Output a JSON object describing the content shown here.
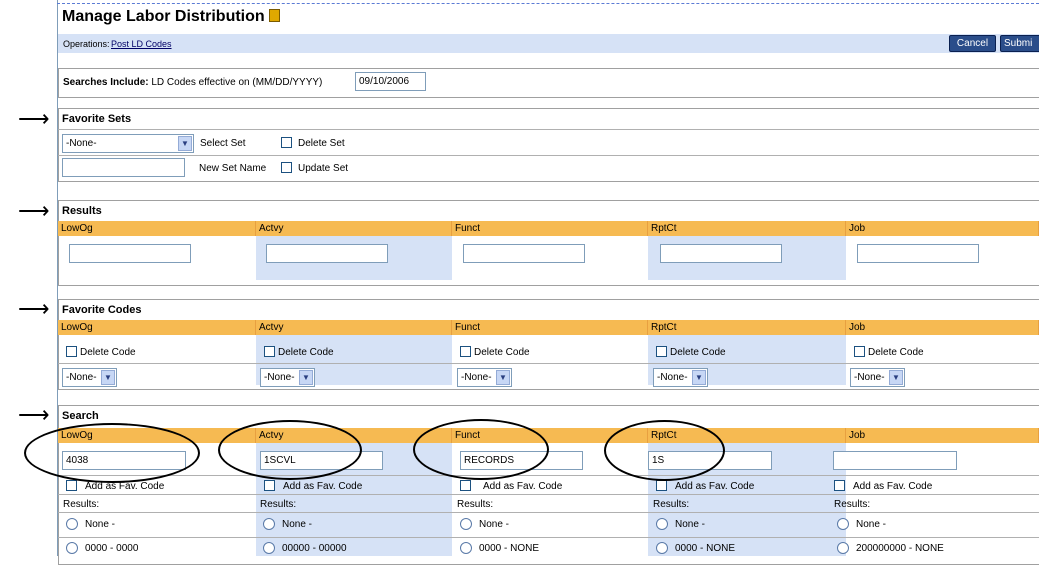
{
  "page": {
    "title": "Manage Labor Distribution",
    "operations_label": "Operations:",
    "operations_link": "Post LD Codes",
    "cancel": "Cancel",
    "submit": "Submi"
  },
  "searches": {
    "label_bold": "Searches Include:",
    "label_rest": "LD Codes effective on (MM/DD/YYYY)",
    "date": "09/10/2006"
  },
  "favorite_sets": {
    "title": "Favorite Sets",
    "select_value": "-None-",
    "select_set": "Select Set",
    "delete_set": "Delete Set",
    "new_set_name": "New Set Name",
    "update_set": "Update Set"
  },
  "columns": [
    "LowOg",
    "Actvy",
    "Funct",
    "RptCt",
    "Job"
  ],
  "results": {
    "title": "Results"
  },
  "favorite_codes": {
    "title": "Favorite Codes",
    "delete_code": "Delete Code",
    "select_value": "-None-"
  },
  "search": {
    "title": "Search",
    "values": [
      "4038",
      "1SCVL",
      "RECORDS",
      "1S",
      ""
    ],
    "add_fav": "Add as Fav. Code",
    "results_label": "Results:",
    "none_option": "None -",
    "codes": [
      "0000  - 0000",
      "00000  - 00000",
      "0000 - NONE",
      "0000 - NONE",
      "200000000 - NONE"
    ]
  },
  "colors": {
    "header": "#f6ba52",
    "band": "#d6e2f6",
    "button": "#2a4d8a"
  }
}
